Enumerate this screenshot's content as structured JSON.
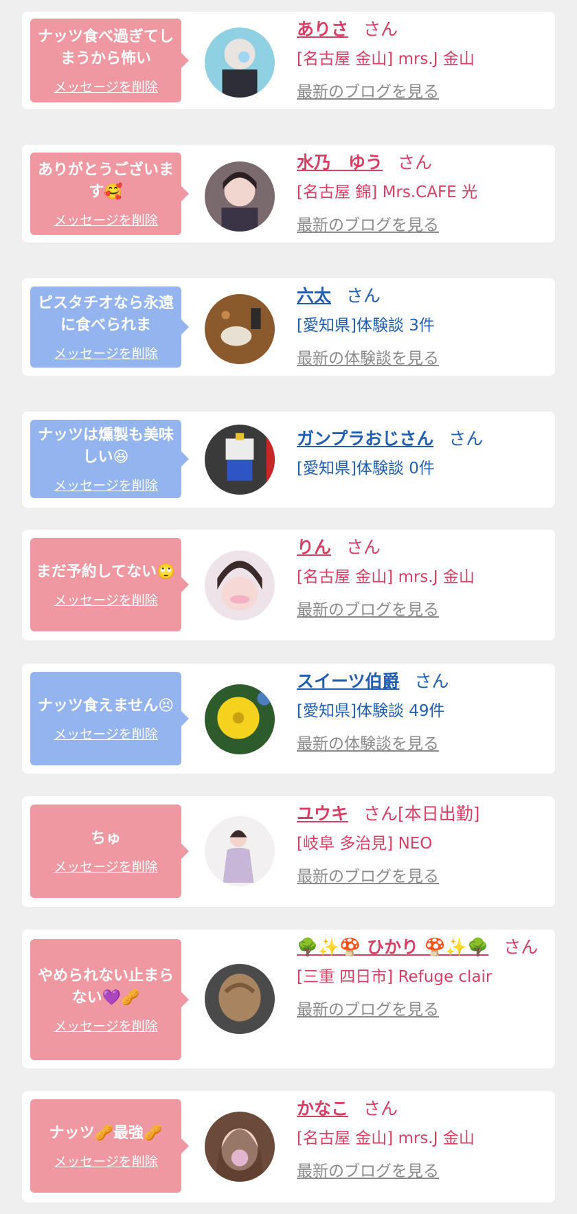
{
  "colors": {
    "pink": "#ef98a2",
    "blue": "#93b4ef",
    "name_pink": "#d63e63",
    "name_blue": "#1f5eb0",
    "link": "#8a8a8a"
  },
  "items": [
    {
      "type": "pink",
      "message": "ナッツ食べ過ぎてしまうから怖い",
      "delete": "メッセージを削除",
      "name": "ありさ",
      "san": "さん",
      "sub": "[名古屋 金山] mrs.J 金山",
      "link": "最新のブログを見る",
      "avatar": "avatar-masked-person"
    },
    {
      "type": "pink",
      "message": "ありがとうございます🥰",
      "delete": "メッセージを削除",
      "name": "水乃　ゆう",
      "san": "さん",
      "sub": "[名古屋 錦] Mrs.CAFE 光",
      "link": "最新のブログを見る",
      "avatar": "avatar-woman"
    },
    {
      "type": "blue",
      "message": "ピスタチオなら永遠に食べられま",
      "delete": "メッセージを削除",
      "name": "六太",
      "san": "さん",
      "sub": "[愛知県]体験談 3件",
      "link": "最新の体験談を見る",
      "avatar": "avatar-table"
    },
    {
      "type": "blue",
      "message": "ナッツは燻製も美味しい😆",
      "delete": "メッセージを削除",
      "name": "ガンプラおじさん",
      "san": "さん",
      "sub": "[愛知県]体験談 0件",
      "link": "",
      "avatar": "avatar-robot"
    },
    {
      "type": "pink",
      "message": "まだ予約してない🙄",
      "delete": "メッセージを削除",
      "name": "りん",
      "san": "さん",
      "sub": "[名古屋 金山] mrs.J 金山",
      "link": "最新のブログを見る",
      "avatar": "avatar-face"
    },
    {
      "type": "blue",
      "message": "ナッツ食えません😣",
      "delete": "メッセージを削除",
      "name": "スイーツ伯爵",
      "san": "さん",
      "sub": "[愛知県]体験談 49件",
      "link": "最新の体験談を見る",
      "avatar": "avatar-flower"
    },
    {
      "type": "pink",
      "message": "ちゅ",
      "delete": "メッセージを削除",
      "name": "ユウキ",
      "san": "さん[本日出勤]",
      "sub": "[岐阜 多治見] NEO",
      "link": "最新のブログを見る",
      "avatar": "avatar-woman-dress"
    },
    {
      "type": "pink",
      "message": "やめられない止まらない💜🥜",
      "delete": "メッセージを削除",
      "name": "🌳✨🍄 ひかり 🍄✨🌳",
      "san": "さん",
      "sub": "[三重 四日市] Refuge clair",
      "link": "最新のブログを見る",
      "avatar": "avatar-hair"
    },
    {
      "type": "pink",
      "message": "ナッツ🥜最強🥜",
      "delete": "メッセージを削除",
      "name": "かなこ",
      "san": "さん",
      "sub": "[名古屋 金山] mrs.J 金山",
      "link": "最新のブログを見る",
      "avatar": "avatar-woman-sparkle"
    }
  ]
}
